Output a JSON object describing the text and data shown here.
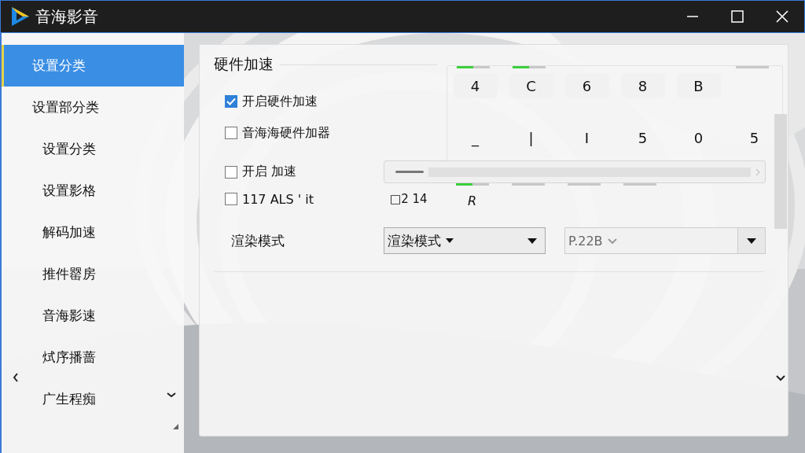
{
  "window": {
    "title": "音海影音"
  },
  "sidebar": {
    "items": [
      {
        "label": "设置分类",
        "selected": true
      },
      {
        "label": "设置部分类",
        "selected": false,
        "children": [
          {
            "label": "设置分类",
            "selected": false
          },
          {
            "label": "设置影格",
            "selected": false
          },
          {
            "label": "解码加速",
            "selected": false
          },
          {
            "label": "推件罂房",
            "selected": false
          },
          {
            "label": "音海影速",
            "selected": false
          },
          {
            "label": "烒序播蔷",
            "selected": false
          },
          {
            "label": "广生程痴",
            "selected": false
          }
        ]
      }
    ]
  },
  "section": {
    "title": "硬件加速"
  },
  "options": [
    {
      "label": "开启硬件加速",
      "checked": true
    },
    {
      "label": "音海海硬件加器",
      "checked": false
    },
    {
      "label": "开启 加速",
      "checked": false
    },
    {
      "label": "117 ALS ' it",
      "checked": false
    }
  ],
  "value_grid": {
    "rows": [
      [
        {
          "text": "4",
          "level": 0.5
        },
        {
          "text": "C",
          "level": 0.5
        },
        {
          "text": "6"
        },
        {
          "text": "8"
        },
        {
          "text": "B"
        },
        {
          "level": 0
        }
      ],
      [
        {
          "text": "_"
        },
        {
          "text": "|"
        },
        {
          "text": "I"
        },
        {
          "text": "5"
        },
        {
          "text": "0"
        },
        {
          "text": "5"
        }
      ]
    ]
  },
  "side_value": "□2 14",
  "meters": [
    {
      "level": 0.5,
      "text": "R"
    },
    {
      "level": 0
    },
    {
      "level": 0
    },
    {
      "level": 0
    }
  ],
  "render": {
    "label": "渲染模式",
    "combo_1": {
      "value": "渲染模式"
    },
    "combo_2": {
      "value": "P.22B"
    }
  }
}
